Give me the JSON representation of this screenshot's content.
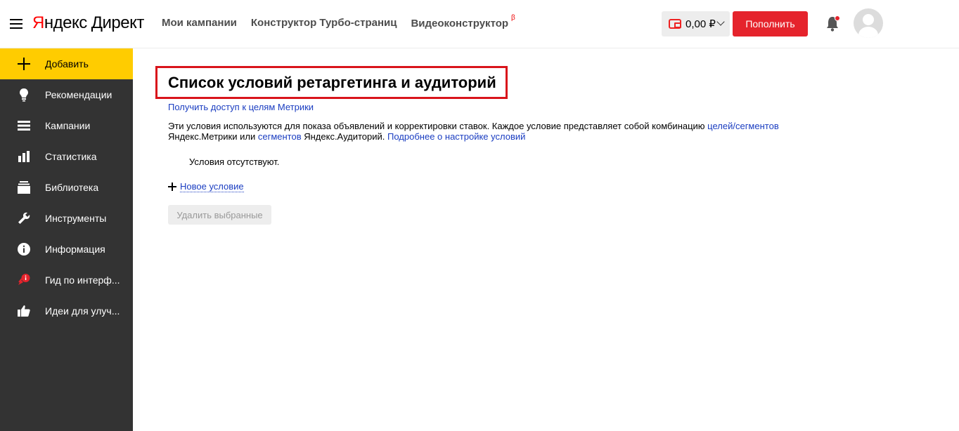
{
  "header": {
    "logo_brand": "Яндекс",
    "logo_product": "Директ",
    "nav": [
      {
        "label": "Мои кампании"
      },
      {
        "label": "Конструктор Турбо-страниц"
      },
      {
        "label": "Видеоконструктор",
        "badge": "β"
      }
    ],
    "balance": "0,00 ₽",
    "topup_label": "Пополнить"
  },
  "sidebar": {
    "items": [
      {
        "label": "Добавить",
        "icon": "plus-icon",
        "active": true
      },
      {
        "label": "Рекомендации",
        "icon": "lightbulb-icon"
      },
      {
        "label": "Кампании",
        "icon": "list-icon"
      },
      {
        "label": "Статистика",
        "icon": "bar-chart-icon"
      },
      {
        "label": "Библиотека",
        "icon": "library-icon"
      },
      {
        "label": "Инструменты",
        "icon": "wrench-icon"
      },
      {
        "label": "Информация",
        "icon": "info-icon"
      },
      {
        "label": "Гид по интерф...",
        "icon": "guide-icon"
      },
      {
        "label": "Идеи для улуч...",
        "icon": "thumbs-up-icon"
      }
    ]
  },
  "main": {
    "title": "Список условий ретаргетинга и аудиторий",
    "metrika_link": "Получить доступ к целям Метрики",
    "desc_part1": "Эти условия используются для показа объявлений и корректировки ставок. Каждое условие представляет собой комбинацию ",
    "desc_link1": "целей/сегментов",
    "desc_part2": " Яндекс.Метрики или ",
    "desc_link2": "сегментов",
    "desc_part3": " Яндекс.Аудиторий. ",
    "desc_link3": "Подробнее о настройке условий",
    "empty_text": "Условия отсутствуют.",
    "new_condition": "Новое условие",
    "delete_selected": "Удалить выбранные"
  },
  "colors": {
    "accent_red": "#e5232c",
    "sidebar_bg": "#333333",
    "active_yellow": "#ffcc00",
    "link_blue": "#1a3dc1",
    "highlight_box": "#d9141b"
  }
}
